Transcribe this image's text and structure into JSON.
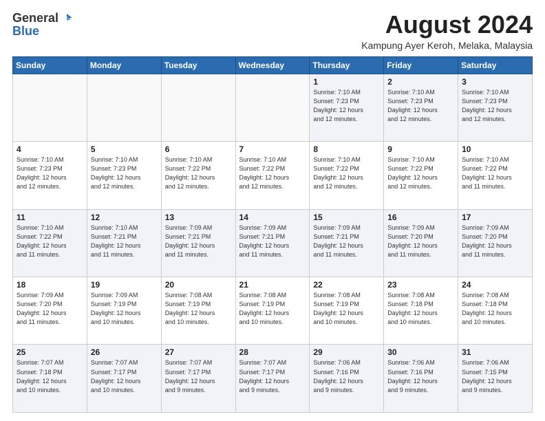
{
  "logo": {
    "line1": "General",
    "line2": "Blue"
  },
  "title": "August 2024",
  "location": "Kampung Ayer Keroh, Melaka, Malaysia",
  "days": [
    "Sunday",
    "Monday",
    "Tuesday",
    "Wednesday",
    "Thursday",
    "Friday",
    "Saturday"
  ],
  "weeks": [
    [
      {
        "day": "",
        "info": ""
      },
      {
        "day": "",
        "info": ""
      },
      {
        "day": "",
        "info": ""
      },
      {
        "day": "",
        "info": ""
      },
      {
        "day": "1",
        "info": "Sunrise: 7:10 AM\nSunset: 7:23 PM\nDaylight: 12 hours\nand 12 minutes."
      },
      {
        "day": "2",
        "info": "Sunrise: 7:10 AM\nSunset: 7:23 PM\nDaylight: 12 hours\nand 12 minutes."
      },
      {
        "day": "3",
        "info": "Sunrise: 7:10 AM\nSunset: 7:23 PM\nDaylight: 12 hours\nand 12 minutes."
      }
    ],
    [
      {
        "day": "4",
        "info": "Sunrise: 7:10 AM\nSunset: 7:23 PM\nDaylight: 12 hours\nand 12 minutes."
      },
      {
        "day": "5",
        "info": "Sunrise: 7:10 AM\nSunset: 7:23 PM\nDaylight: 12 hours\nand 12 minutes."
      },
      {
        "day": "6",
        "info": "Sunrise: 7:10 AM\nSunset: 7:22 PM\nDaylight: 12 hours\nand 12 minutes."
      },
      {
        "day": "7",
        "info": "Sunrise: 7:10 AM\nSunset: 7:22 PM\nDaylight: 12 hours\nand 12 minutes."
      },
      {
        "day": "8",
        "info": "Sunrise: 7:10 AM\nSunset: 7:22 PM\nDaylight: 12 hours\nand 12 minutes."
      },
      {
        "day": "9",
        "info": "Sunrise: 7:10 AM\nSunset: 7:22 PM\nDaylight: 12 hours\nand 12 minutes."
      },
      {
        "day": "10",
        "info": "Sunrise: 7:10 AM\nSunset: 7:22 PM\nDaylight: 12 hours\nand 11 minutes."
      }
    ],
    [
      {
        "day": "11",
        "info": "Sunrise: 7:10 AM\nSunset: 7:22 PM\nDaylight: 12 hours\nand 11 minutes."
      },
      {
        "day": "12",
        "info": "Sunrise: 7:10 AM\nSunset: 7:21 PM\nDaylight: 12 hours\nand 11 minutes."
      },
      {
        "day": "13",
        "info": "Sunrise: 7:09 AM\nSunset: 7:21 PM\nDaylight: 12 hours\nand 11 minutes."
      },
      {
        "day": "14",
        "info": "Sunrise: 7:09 AM\nSunset: 7:21 PM\nDaylight: 12 hours\nand 11 minutes."
      },
      {
        "day": "15",
        "info": "Sunrise: 7:09 AM\nSunset: 7:21 PM\nDaylight: 12 hours\nand 11 minutes."
      },
      {
        "day": "16",
        "info": "Sunrise: 7:09 AM\nSunset: 7:20 PM\nDaylight: 12 hours\nand 11 minutes."
      },
      {
        "day": "17",
        "info": "Sunrise: 7:09 AM\nSunset: 7:20 PM\nDaylight: 12 hours\nand 11 minutes."
      }
    ],
    [
      {
        "day": "18",
        "info": "Sunrise: 7:09 AM\nSunset: 7:20 PM\nDaylight: 12 hours\nand 11 minutes."
      },
      {
        "day": "19",
        "info": "Sunrise: 7:09 AM\nSunset: 7:19 PM\nDaylight: 12 hours\nand 10 minutes."
      },
      {
        "day": "20",
        "info": "Sunrise: 7:08 AM\nSunset: 7:19 PM\nDaylight: 12 hours\nand 10 minutes."
      },
      {
        "day": "21",
        "info": "Sunrise: 7:08 AM\nSunset: 7:19 PM\nDaylight: 12 hours\nand 10 minutes."
      },
      {
        "day": "22",
        "info": "Sunrise: 7:08 AM\nSunset: 7:19 PM\nDaylight: 12 hours\nand 10 minutes."
      },
      {
        "day": "23",
        "info": "Sunrise: 7:08 AM\nSunset: 7:18 PM\nDaylight: 12 hours\nand 10 minutes."
      },
      {
        "day": "24",
        "info": "Sunrise: 7:08 AM\nSunset: 7:18 PM\nDaylight: 12 hours\nand 10 minutes."
      }
    ],
    [
      {
        "day": "25",
        "info": "Sunrise: 7:07 AM\nSunset: 7:18 PM\nDaylight: 12 hours\nand 10 minutes."
      },
      {
        "day": "26",
        "info": "Sunrise: 7:07 AM\nSunset: 7:17 PM\nDaylight: 12 hours\nand 10 minutes."
      },
      {
        "day": "27",
        "info": "Sunrise: 7:07 AM\nSunset: 7:17 PM\nDaylight: 12 hours\nand 9 minutes."
      },
      {
        "day": "28",
        "info": "Sunrise: 7:07 AM\nSunset: 7:17 PM\nDaylight: 12 hours\nand 9 minutes."
      },
      {
        "day": "29",
        "info": "Sunrise: 7:06 AM\nSunset: 7:16 PM\nDaylight: 12 hours\nand 9 minutes."
      },
      {
        "day": "30",
        "info": "Sunrise: 7:06 AM\nSunset: 7:16 PM\nDaylight: 12 hours\nand 9 minutes."
      },
      {
        "day": "31",
        "info": "Sunrise: 7:06 AM\nSunset: 7:15 PM\nDaylight: 12 hours\nand 9 minutes."
      }
    ]
  ]
}
